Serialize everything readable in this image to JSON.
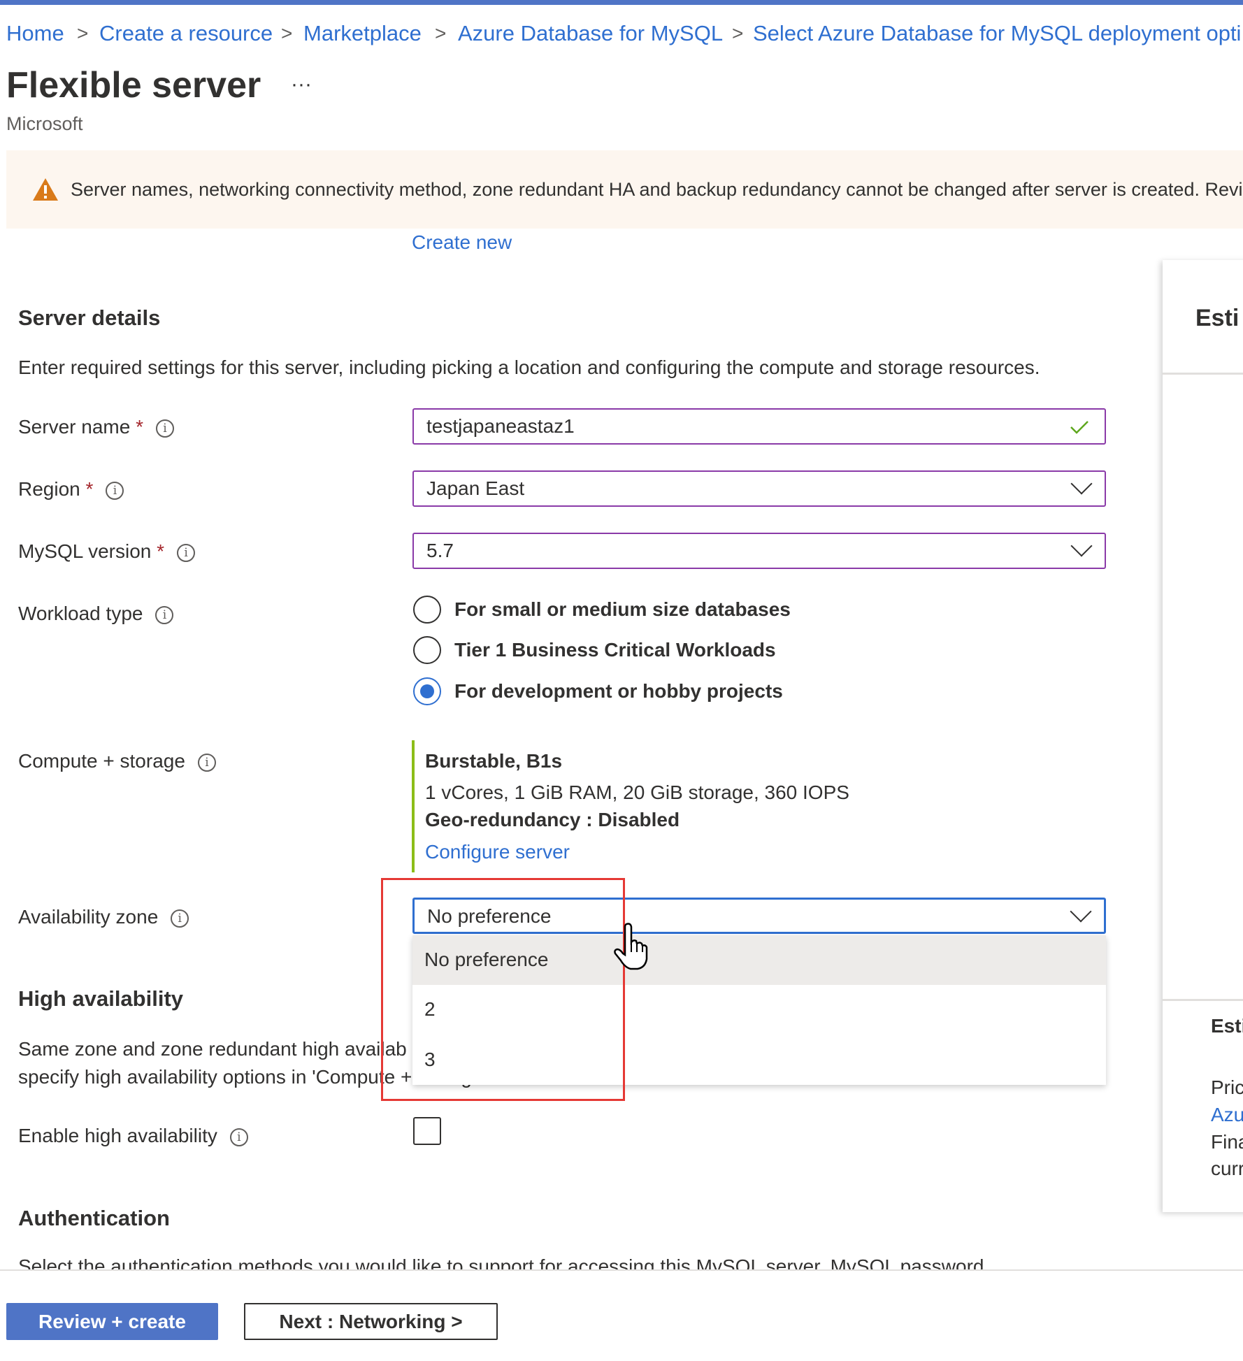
{
  "breadcrumb": [
    "Home",
    "Create a resource",
    "Marketplace",
    "Azure Database for MySQL",
    "Select Azure Database for MySQL deployment opti"
  ],
  "header": {
    "title": "Flexible server",
    "more": "···",
    "publisher": "Microsoft"
  },
  "warning": {
    "text": "Server names, networking connectivity method, zone redundant HA and backup redundancy cannot be changed after server is created. Revie",
    "icon": "warning-triangle-icon"
  },
  "create_new": "Create new",
  "server_details": {
    "heading": "Server details",
    "description": "Enter required settings for this server, including picking a location and configuring the compute and storage resources.",
    "server_name": {
      "label": "Server name",
      "required": "*",
      "value": "testjapaneastaz1"
    },
    "region": {
      "label": "Region",
      "required": "*",
      "value": "Japan East"
    },
    "mysql_version": {
      "label": "MySQL version",
      "required": "*",
      "value": "5.7"
    },
    "workload_type": {
      "label": "Workload type",
      "options": [
        "For small or medium size databases",
        "Tier 1 Business Critical Workloads",
        "For development or hobby projects"
      ],
      "selected": 2
    },
    "compute": {
      "label": "Compute + storage",
      "tier": "Burstable, B1s",
      "specs": "1 vCores, 1 GiB RAM, 20 GiB storage, 360 IOPS",
      "geo": "Geo-redundancy : Disabled",
      "configure": "Configure server"
    },
    "availability_zone": {
      "label": "Availability zone",
      "value": "No preference",
      "options": [
        "No preference",
        "2",
        "3"
      ]
    }
  },
  "high_availability": {
    "heading": "High availability",
    "description_line1": "Same zone and zone redundant high availab",
    "description_line2": "specify high availability options in 'Compute + storage'",
    "enable_label": "Enable high availability",
    "enabled": false
  },
  "authentication": {
    "heading": "Authentication",
    "description": "Select the authentication methods you would like to support for accessing this MySQL server. MySQL password"
  },
  "cost_panel": {
    "heading": "Esti",
    "section2": "Esti",
    "lines": [
      "Pric",
      "Azu",
      "Fina",
      "curr"
    ]
  },
  "footer": {
    "review": "Review + create",
    "next": "Next : Networking >"
  },
  "colors": {
    "accent": "#2f6fd0",
    "focus_border": "#8a3aa8",
    "highlight": "#e53935",
    "success": "#5ea71e",
    "warning": "#d97a1a"
  }
}
